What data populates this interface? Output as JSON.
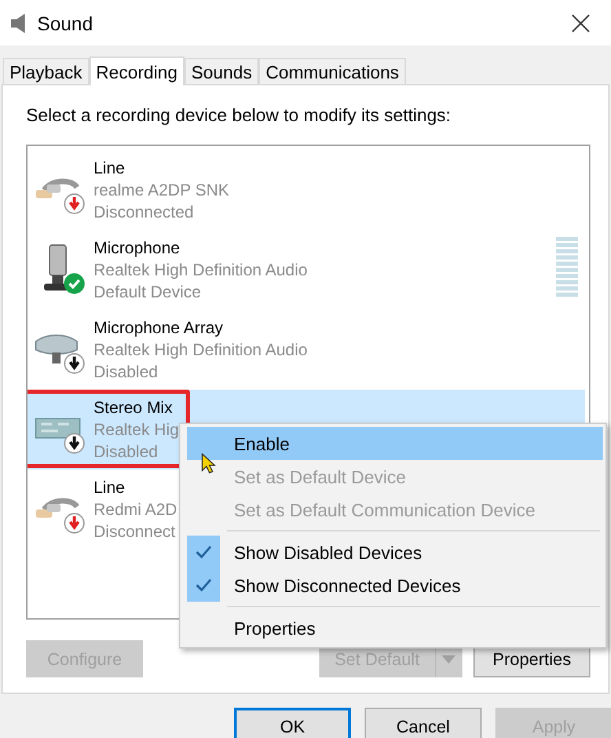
{
  "window": {
    "title": "Sound"
  },
  "tabs": [
    {
      "label": "Playback",
      "selected": false
    },
    {
      "label": "Recording",
      "selected": true
    },
    {
      "label": "Sounds",
      "selected": false
    },
    {
      "label": "Communications",
      "selected": false
    }
  ],
  "instruction": "Select a recording device below to modify its settings:",
  "devices": [
    {
      "kind": "line",
      "name": "Line",
      "driver": "realme A2DP SNK",
      "status_text": "Disconnected",
      "disconnected": true,
      "disabled": false,
      "is_default": false,
      "selected": false,
      "highlighted": false
    },
    {
      "kind": "microphone",
      "name": "Microphone",
      "driver": "Realtek High Definition Audio",
      "status_text": "Default Device",
      "disconnected": false,
      "disabled": false,
      "is_default": true,
      "selected": false,
      "highlighted": false,
      "level": 0
    },
    {
      "kind": "mic-array",
      "name": "Microphone Array",
      "driver": "Realtek High Definition Audio",
      "status_text": "Disabled",
      "disconnected": false,
      "disabled": true,
      "is_default": false,
      "selected": false,
      "highlighted": false
    },
    {
      "kind": "stereo-mix",
      "name": "Stereo Mix",
      "driver": "Realtek Hig",
      "status_text": "Disabled",
      "disconnected": false,
      "disabled": true,
      "is_default": false,
      "selected": true,
      "highlighted": true
    },
    {
      "kind": "line",
      "name": "Line",
      "driver": "Redmi A2D",
      "status_text": "Disconnect",
      "disconnected": true,
      "disabled": false,
      "is_default": false,
      "selected": false,
      "highlighted": false
    }
  ],
  "context_menu": [
    {
      "kind": "item",
      "label": "Enable",
      "hovered": true,
      "disabled": false,
      "checked": false
    },
    {
      "kind": "item",
      "label": "Set as Default Device",
      "hovered": false,
      "disabled": true,
      "checked": false
    },
    {
      "kind": "item",
      "label": "Set as Default Communication Device",
      "hovered": false,
      "disabled": true,
      "checked": false
    },
    {
      "kind": "separator"
    },
    {
      "kind": "item",
      "label": "Show Disabled Devices",
      "hovered": false,
      "disabled": false,
      "checked": true
    },
    {
      "kind": "item",
      "label": "Show Disconnected Devices",
      "hovered": false,
      "disabled": false,
      "checked": true
    },
    {
      "kind": "separator"
    },
    {
      "kind": "item",
      "label": "Properties",
      "hovered": false,
      "disabled": false,
      "checked": false
    }
  ],
  "panel_buttons": {
    "configure": {
      "label": "Configure",
      "disabled": true
    },
    "set_default": {
      "label": "Set Default",
      "disabled": true
    },
    "properties": {
      "label": "Properties",
      "disabled": false
    }
  },
  "dialog_buttons": [
    {
      "label": "OK",
      "focused": true,
      "disabled": false
    },
    {
      "label": "Cancel",
      "focused": false,
      "disabled": false
    },
    {
      "label": "Apply",
      "focused": false,
      "disabled": true
    }
  ]
}
